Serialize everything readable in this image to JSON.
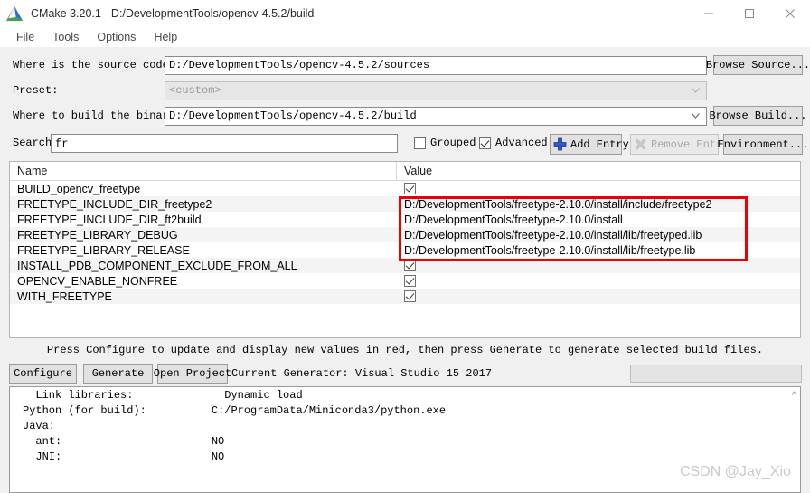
{
  "window": {
    "title": "CMake 3.20.1 - D:/DevelopmentTools/opencv-4.5.2/build",
    "icon": "cmake-logo-icon",
    "minimize": "minimize-icon",
    "maximize": "maximize-icon",
    "close": "close-icon"
  },
  "menu": {
    "items": [
      {
        "label": "File"
      },
      {
        "label": "Tools"
      },
      {
        "label": "Options"
      },
      {
        "label": "Help"
      }
    ]
  },
  "form": {
    "source_label": "Where is the source code:",
    "source_value": "D:/DevelopmentTools/opencv-4.5.2/sources",
    "browse_source_label": "Browse Source...",
    "preset_label": "Preset:",
    "preset_value": "<custom>",
    "build_label": "Where to build the binaries:",
    "build_value": "D:/DevelopmentTools/opencv-4.5.2/build",
    "browse_build_label": "Browse Build..."
  },
  "toolbar": {
    "search_label": "Search:",
    "search_value": "fr",
    "search_placeholder": "",
    "grouped_label": "Grouped",
    "grouped_checked": false,
    "advanced_label": "Advanced",
    "advanced_checked": true,
    "add_entry_label": "Add Entry",
    "add_entry_icon": "plus-icon",
    "remove_entry_label": "Remove Entry",
    "remove_entry_icon": "remove-x-icon",
    "remove_entry_enabled": false,
    "environment_label": "Environment..."
  },
  "table": {
    "columns": [
      "Name",
      "Value"
    ],
    "rows": [
      {
        "name": "BUILD_opencv_freetype",
        "type": "bool",
        "value": "checked"
      },
      {
        "name": "FREETYPE_INCLUDE_DIR_freetype2",
        "type": "path",
        "value": "D:/DevelopmentTools/freetype-2.10.0/install/include/freetype2"
      },
      {
        "name": "FREETYPE_INCLUDE_DIR_ft2build",
        "type": "path",
        "value": "D:/DevelopmentTools/freetype-2.10.0/install"
      },
      {
        "name": "FREETYPE_LIBRARY_DEBUG",
        "type": "path",
        "value": "D:/DevelopmentTools/freetype-2.10.0/install/lib/freetyped.lib"
      },
      {
        "name": "FREETYPE_LIBRARY_RELEASE",
        "type": "path",
        "value": "D:/DevelopmentTools/freetype-2.10.0/install/lib/freetype.lib"
      },
      {
        "name": "INSTALL_PDB_COMPONENT_EXCLUDE_FROM_ALL",
        "type": "bool",
        "value": "checked"
      },
      {
        "name": "OPENCV_ENABLE_NONFREE",
        "type": "bool",
        "value": "checked"
      },
      {
        "name": "WITH_FREETYPE",
        "type": "bool",
        "value": "checked"
      }
    ]
  },
  "actions": {
    "hint": "Press Configure to update and display new values in red, then press Generate to generate selected build files.",
    "configure_label": "Configure",
    "generate_label": "Generate",
    "open_project_label": "Open Project",
    "generator_text": "Current Generator: Visual Studio 15 2017"
  },
  "log": {
    "lines": [
      "  Link libraries:              Dynamic load",
      "",
      "Python (for build):          C:/ProgramData/Miniconda3/python.exe",
      "",
      "Java:",
      "  ant:                       NO",
      "  JNI:                       NO"
    ],
    "scroll_up_icon": "chevron-up-icon"
  },
  "annotations": {
    "highlight_color": "#ef0000"
  },
  "watermark": {
    "text": "CSDN @Jay_Xio"
  }
}
